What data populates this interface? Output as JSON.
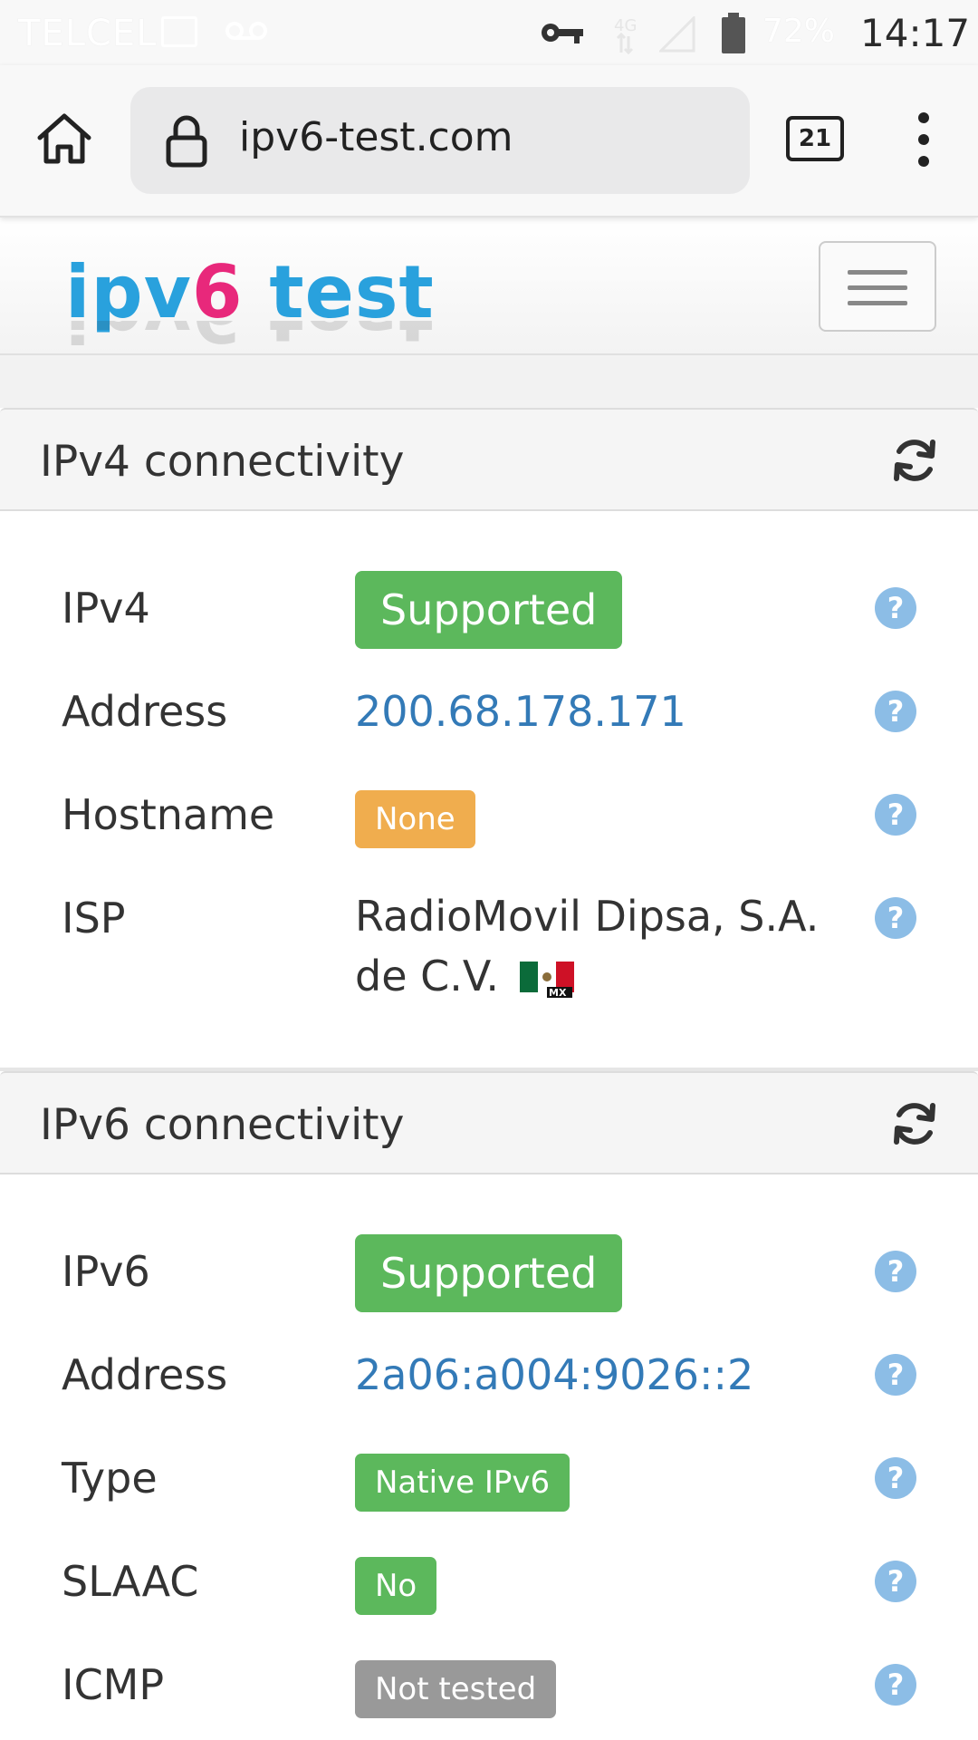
{
  "status_bar": {
    "carrier": "TELCEL",
    "battery_percent": "72%",
    "time": "14:17",
    "icons": [
      "image-icon",
      "voicemail-icon",
      "vpn-key-icon",
      "mobile-data-icon",
      "signal-icon",
      "battery-icon"
    ]
  },
  "browser": {
    "url": "ipv6-test.com",
    "tab_count": "21"
  },
  "site": {
    "logo_part1": "ipv",
    "logo_part2": "6",
    "logo_part3": " test"
  },
  "ipv4_panel": {
    "title": "IPv4 connectivity",
    "rows": [
      {
        "label": "IPv4",
        "value": "Supported"
      },
      {
        "label": "Address",
        "value": "200.68.178.171"
      },
      {
        "label": "Hostname",
        "value": "None"
      },
      {
        "label": "ISP",
        "value": "RadioMovil Dipsa, S.A. de C.V.",
        "flag": "MX"
      }
    ]
  },
  "ipv6_panel": {
    "title": "IPv6 connectivity",
    "rows": [
      {
        "label": "IPv6",
        "value": "Supported"
      },
      {
        "label": "Address",
        "value": "2a06:a004:9026::2"
      },
      {
        "label": "Type",
        "value": "Native IPv6"
      },
      {
        "label": "SLAAC",
        "value": "No"
      },
      {
        "label": "ICMP",
        "value": "Not tested"
      }
    ]
  },
  "help_symbol": "?",
  "colors": {
    "success": "#5cb85c",
    "warning": "#f0ad4e",
    "default": "#999999",
    "link": "#337ab7",
    "logo_blue": "#29a1dd",
    "logo_pink": "#e8287b"
  }
}
